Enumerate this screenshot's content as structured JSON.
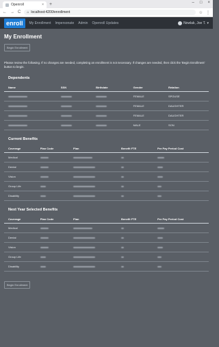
{
  "browser": {
    "tab_title": "Openroll",
    "tab_close": "×",
    "new_tab": "+",
    "win_controls": [
      "–",
      "□",
      "×"
    ],
    "nav_back": "←",
    "nav_forward": "→",
    "reload": "C",
    "home": "⌂",
    "url": "localhost:4200/enrollment",
    "addr_right": [
      "☆",
      "⋮"
    ]
  },
  "navbar": {
    "logo": "enroll",
    "links": [
      "My Enrollment",
      "Impersonate",
      "Admin",
      "Openroll Updates"
    ],
    "user": "Nowlak, Joe T.",
    "user_caret": "▾"
  },
  "page": {
    "title": "My Enrollment",
    "begin_button_top": "Begin Enrollment",
    "notice": "Please review the following. If no changes are needed, completing an enrollment is not necessary. If changes are needed, then click the 'Begin Enrollment' button to begin.",
    "begin_button_bottom": "Begin Enrollment"
  },
  "dependents": {
    "title": "Dependents",
    "columns": [
      "Name",
      "SSN",
      "Birthdate",
      "Gender",
      "Relation"
    ],
    "rows": [
      {
        "gender": "FEMALE",
        "relation": "SPOUSE"
      },
      {
        "gender": "FEMALE",
        "relation": "DAUGHTER"
      },
      {
        "gender": "FEMALE",
        "relation": "DAUGHTER"
      },
      {
        "gender": "MALE",
        "relation": "SON"
      }
    ]
  },
  "current_benefits": {
    "title": "Current Benefits",
    "columns": [
      "Coverage",
      "Plan Code",
      "Plan",
      "Benefit FTE",
      "Per Pay Period Cost"
    ],
    "rows": [
      {
        "coverage": "Medical"
      },
      {
        "coverage": "Dental"
      },
      {
        "coverage": "Vision"
      },
      {
        "coverage": "Group Life"
      },
      {
        "coverage": "Disability"
      }
    ]
  },
  "next_year_benefits": {
    "title": "Next Year Selected Benefits",
    "columns": [
      "Coverage",
      "Plan Code",
      "Plan",
      "Benefit FTE",
      "Per Pay Period Cost"
    ],
    "rows": [
      {
        "coverage": "Medical"
      },
      {
        "coverage": "Dental"
      },
      {
        "coverage": "Vision"
      },
      {
        "coverage": "Group Life"
      },
      {
        "coverage": "Disability"
      }
    ]
  },
  "colors": {
    "page_bg": "#5a5f66",
    "navbar_bg": "#2d3137",
    "brand": "#1c7bd4"
  }
}
